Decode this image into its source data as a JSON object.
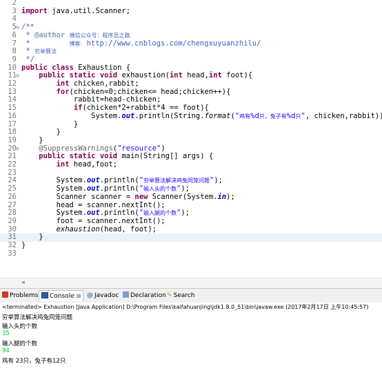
{
  "editor": {
    "lines": [
      {
        "n": "2",
        "html": ""
      },
      {
        "n": "3",
        "html": "<span class=\"kw\">import</span> java.util.Scanner;"
      },
      {
        "n": "4",
        "html": ""
      },
      {
        "n": "5",
        "fold": true,
        "html": "<span class=\"jd\">/**</span>"
      },
      {
        "n": "6",
        "html": "<span class=\"jd\"> * </span><span class=\"tag\">@author</span><span class=\"jd\"> <span class=\"cjk\">微信公众号：程序员之路</span></span>"
      },
      {
        "n": "7",
        "html": "<span class=\"jd\"> *         <span class=\"cjk\">博客:</span> http://www.cnblogs.com/chengxuyuanzhilu/</span>"
      },
      {
        "n": "8",
        "html": "<span class=\"jd\"> * <span class=\"cjk\">穷举算法</span></span>"
      },
      {
        "n": "9",
        "html": "<span class=\"jd\"> */</span>"
      },
      {
        "n": "10",
        "html": "<span class=\"kw\">public</span> <span class=\"kw\">class</span> Exhaustion {"
      },
      {
        "n": "11",
        "fold": true,
        "html": "    <span class=\"kw\">public</span> <span class=\"kw\">static</span> <span class=\"kw\">void</span> exhaustion(<span class=\"kw\">int</span> head,<span class=\"kw\">int</span> foot){"
      },
      {
        "n": "12",
        "html": "        <span class=\"kw\">int</span> chicken,rabbit;"
      },
      {
        "n": "13",
        "html": "        <span class=\"kw\">for</span>(chicken=0;chicken&lt;= head;chicken++){"
      },
      {
        "n": "14",
        "html": "            rabbit=head-chicken;"
      },
      {
        "n": "15",
        "html": "            <span class=\"kw\">if</span>(chicken*2+rabbit*4 == foot){"
      },
      {
        "n": "16",
        "html": "                System.<span class=\"fld\">out</span>.println(String.<span class=\"it\">format</span>(<span class=\"str\">\"<span class=\"cjk\">鸡有</span>%d<span class=\"cjk\">只，兔子有</span>%d<span class=\"cjk\">只</span>\"</span>, chicken,rabbit));"
      },
      {
        "n": "17",
        "html": "            }"
      },
      {
        "n": "18",
        "html": "        }"
      },
      {
        "n": "19",
        "html": "    }"
      },
      {
        "n": "20",
        "fold": true,
        "html": "    <span class=\"ann\">@SuppressWarnings</span>(<span class=\"str\">\"resource\"</span>)"
      },
      {
        "n": "21",
        "html": "    <span class=\"kw\">public</span> <span class=\"kw\">static</span> <span class=\"kw\">void</span> main(String[] args) {"
      },
      {
        "n": "22",
        "html": "        <span class=\"kw\">int</span> head,foot;"
      },
      {
        "n": "23",
        "html": ""
      },
      {
        "n": "24",
        "html": "        System.<span class=\"fld\">out</span>.println(<span class=\"str\">\"<span class=\"cjk\">穷举算法解决鸡兔同笼问题</span>\"</span>);"
      },
      {
        "n": "25",
        "html": "        System.<span class=\"fld\">out</span>.println(<span class=\"str\">\"<span class=\"cjk\">输入头的个数</span>\"</span>);"
      },
      {
        "n": "26",
        "html": "        Scanner scanner = <span class=\"kw\">new</span> Scanner(System.<span class=\"fld\">in</span>);"
      },
      {
        "n": "27",
        "html": "        head = scanner.nextInt();"
      },
      {
        "n": "28",
        "html": "        System.<span class=\"fld\">out</span>.println(<span class=\"str\">\"<span class=\"cjk\">输入腿的个数</span>\"</span>);"
      },
      {
        "n": "29",
        "html": "        foot = scanner.nextInt();"
      },
      {
        "n": "30",
        "html": "        <span class=\"it\">exhaustion</span>(head, foot);"
      },
      {
        "n": "31",
        "hl": true,
        "html": "    }"
      },
      {
        "n": "32",
        "html": "}"
      },
      {
        "n": "33",
        "html": ""
      }
    ]
  },
  "tabs": {
    "problems": "Problems",
    "console": "Console",
    "console_close": "⊠",
    "javadoc": "Javadoc",
    "declaration": "Declaration",
    "search": "Search"
  },
  "console": {
    "terminated": "<terminated> Exhaustion [Java Application] D:\\Program Files\\kaifahuanjing\\jdk1.8.0_51\\bin\\javaw.exe (2017年2月17日 上午10:45:57)",
    "lines": [
      {
        "text": "穷举算法解决鸡兔同笼问题",
        "input": false
      },
      {
        "text": "输入头的个数",
        "input": false
      },
      {
        "text": "35",
        "input": true
      },
      {
        "text": "输入腿的个数",
        "input": false
      },
      {
        "text": "94",
        "input": true
      },
      {
        "text": "鸡有 23只，兔子有12只",
        "input": false
      }
    ]
  },
  "colors": {
    "keyword": "#7f0055",
    "comment": "#3f5fbf",
    "string": "#2a00ff",
    "field": "#0000c0",
    "console_input": "#00c800"
  }
}
